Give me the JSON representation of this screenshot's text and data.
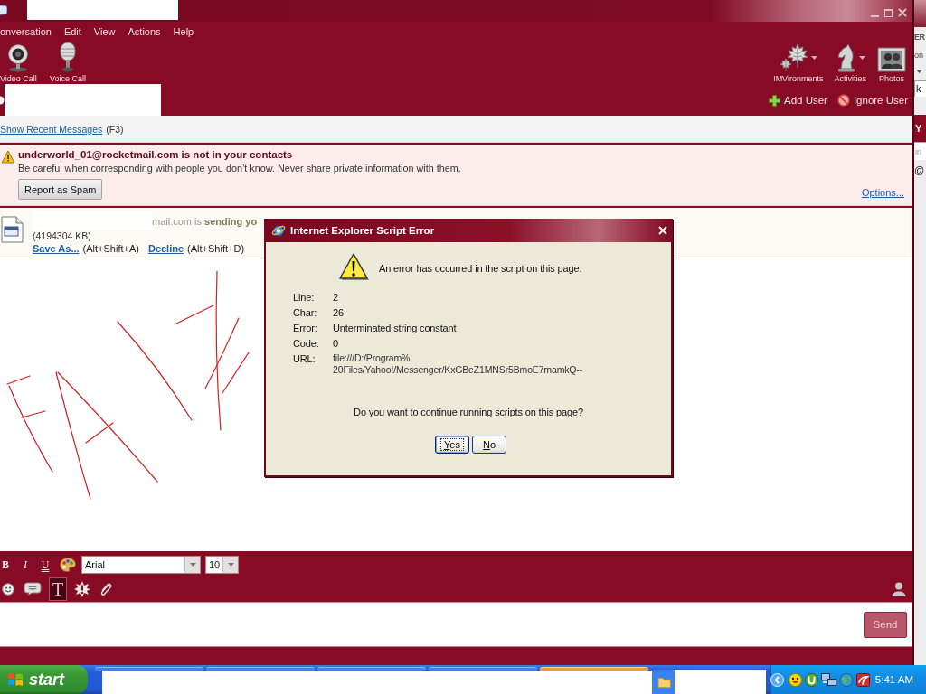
{
  "menu": [
    "onversation",
    "Edit",
    "View",
    "Actions",
    "Help"
  ],
  "toolbar_left": [
    {
      "label": "Video Call",
      "kind": "webcam"
    },
    {
      "label": "Voice Call",
      "kind": "microphone"
    }
  ],
  "toolbar_right": [
    {
      "label": "IMVironments",
      "kind": "leaves",
      "dropdown": true
    },
    {
      "label": "Activities",
      "kind": "knight",
      "dropdown": true
    },
    {
      "label": "Photos",
      "kind": "photos",
      "dropdown": false
    }
  ],
  "contact_actions": [
    {
      "label": "Add User",
      "kind": "add"
    },
    {
      "label": "Ignore User",
      "kind": "ignore"
    }
  ],
  "recent_messages": {
    "link": "Show Recent Messages",
    "shortcut": "(F3)"
  },
  "warning": {
    "title": "underworld_01@rocketmail.com is not in your contacts",
    "text": "Be careful when corresponding with people you don’t know. Never share private information with them.",
    "button": "Report as Spam",
    "options": "Options..."
  },
  "file_transfer": {
    "headline": "mail.com is **sending yo**",
    "size": "(4194304 KB)",
    "actions": [
      {
        "label": "Save As...",
        "shortcut": "(Alt+Shift+A)"
      },
      {
        "label": "Decline",
        "shortcut": "(Alt+Shift+D)"
      }
    ]
  },
  "format_bar": {
    "styles": [
      {
        "label": "B",
        "kind": "bold"
      },
      {
        "label": "I",
        "kind": "italic"
      },
      {
        "label": "U",
        "kind": "underline"
      }
    ],
    "font": "Arial",
    "size": "10"
  },
  "insert_bar": [
    {
      "kind": "emoticon",
      "selected": false
    },
    {
      "kind": "audible",
      "selected": false
    },
    {
      "kind": "text",
      "label": "T",
      "selected": true
    },
    {
      "kind": "buzz",
      "selected": false
    },
    {
      "kind": "attach",
      "selected": false
    }
  ],
  "send_button": {
    "label": "Send",
    "disabled": true
  },
  "dialog": {
    "title": "Internet Explorer Script Error",
    "message": "An error has occurred in the script on this page.",
    "fields": [
      {
        "label": "Line:",
        "lines": [
          "2"
        ]
      },
      {
        "label": "Char:",
        "lines": [
          "26"
        ]
      },
      {
        "label": "Error:",
        "lines": [
          "Unterminated string constant"
        ]
      },
      {
        "label": "Code:",
        "lines": [
          "0"
        ]
      },
      {
        "label": "URL:",
        "lines": [
          "file:///D:/Program%",
          "20Files/Yahoo!/Messenger/KxGBeZ1MNSr5BmoE7mamkQ--"
        ]
      }
    ],
    "question": "Do you want to continue running scripts on this page?",
    "buttons": [
      {
        "label": "Yes",
        "selected": true
      },
      {
        "label": "No",
        "selected": false
      }
    ]
  },
  "taskbar": {
    "start": "start",
    "task_buttons": [
      {
        "selected": false
      },
      {
        "selected": false
      },
      {
        "selected": false
      },
      {
        "selected": false
      },
      {
        "selected": true
      }
    ],
    "tray_icons": [
      {
        "kind": "smiley"
      },
      {
        "kind": "circle-u"
      },
      {
        "kind": "computers"
      },
      {
        "kind": "globe"
      },
      {
        "kind": "square-app"
      }
    ],
    "clock": "5:41 AM"
  },
  "side_window": {
    "title": "ER",
    "label": "on",
    "field": "k",
    "band": "Y",
    "placeholder": "in",
    "text": "@"
  }
}
